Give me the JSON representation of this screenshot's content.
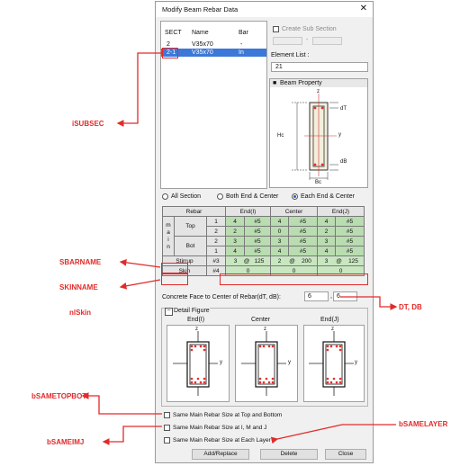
{
  "dialog": {
    "title": "Modify Beam Rebar Data",
    "close_glyph": "✕"
  },
  "section_list": {
    "headers": [
      "SECT",
      "Name",
      "Bar"
    ],
    "rows": [
      {
        "sect": "2",
        "name": "V35x70",
        "bar": "-"
      },
      {
        "sect": "2-1",
        "name": "V35x70",
        "bar": "In"
      }
    ]
  },
  "create_sub_section": "Create Sub Section",
  "sub_section_sep": "-",
  "element_list": {
    "label": "Element List :",
    "value": "21"
  },
  "beam_property": {
    "title": "Beam Property",
    "labels": {
      "top_z": "z",
      "dT": "dT",
      "y": "y",
      "Hc": "Hc",
      "dB": "dB",
      "Bc": "Bc"
    }
  },
  "radio_options": [
    {
      "label": "All Section",
      "checked": false
    },
    {
      "label": "Both End & Center",
      "checked": false
    },
    {
      "label": "Each End & Center",
      "checked": true
    }
  ],
  "rebar_table": {
    "headers": {
      "rebar": "Rebar",
      "end_i": "End(I)",
      "center": "Center",
      "end_j": "End(J)"
    },
    "main_label": [
      "m",
      "a",
      "i",
      "n"
    ],
    "top_label": "Top",
    "bot_label": "Bot",
    "top_rows": [
      {
        "layer": "1",
        "vals": [
          "4",
          "#5",
          "4",
          "#5",
          "4",
          "#5"
        ]
      },
      {
        "layer": "2",
        "vals": [
          "2",
          "#5",
          "0",
          "#5",
          "2",
          "#5"
        ]
      }
    ],
    "bot_rows": [
      {
        "layer": "2",
        "vals": [
          "3",
          "#5",
          "3",
          "#5",
          "3",
          "#5"
        ]
      },
      {
        "layer": "1",
        "vals": [
          "4",
          "#5",
          "4",
          "#5",
          "4",
          "#5"
        ]
      }
    ],
    "stirrup": {
      "label": "Stirrup",
      "size": "#3",
      "vals": [
        "3",
        "@",
        "125",
        "2",
        "@",
        "200",
        "3",
        "@",
        "125"
      ]
    },
    "skin": {
      "label": "Skin",
      "size": "#4",
      "vals": [
        "0",
        "0",
        "0"
      ]
    }
  },
  "concrete_face": {
    "label": "Concrete Face to Center of Rebar(dT, dB):",
    "dT": "6",
    "dB": "6",
    "sep": ","
  },
  "detail_figure": {
    "title": "Detail Figure",
    "collapse_glyph": "−",
    "panels": [
      {
        "title": "End(I)",
        "z": "z",
        "y": "y"
      },
      {
        "title": "Center",
        "z": "z",
        "y": "y"
      },
      {
        "title": "End(J)",
        "z": "z",
        "y": "y"
      }
    ]
  },
  "checkboxes": [
    {
      "label": "Same Main Rebar Size at Top and Bottom",
      "checked": false
    },
    {
      "label": "Same Main Rebar Size at I, M and J",
      "checked": false
    },
    {
      "label": "Same Main Rebar Size at Each Layer",
      "checked": false
    }
  ],
  "buttons": {
    "add_replace": "Add/Replace",
    "delete": "Delete",
    "close": "Close"
  },
  "annotations": {
    "isubsec": "iSUBSEC",
    "sbarname": "SBARNAME",
    "skinname": "SKINNAME",
    "nlskin": "nlSkin",
    "dt_db": "DT, DB",
    "bsametopbot": "bSAMETOPBOT",
    "bsameimj": "bSAMEIMJ",
    "bsamelayer": "bSAMELAYER"
  },
  "colors": {
    "annotation": "#e22a2a",
    "selection": "#3c78d8",
    "table_green": "#b9dcb0",
    "rebar_dot": "#e03030"
  }
}
